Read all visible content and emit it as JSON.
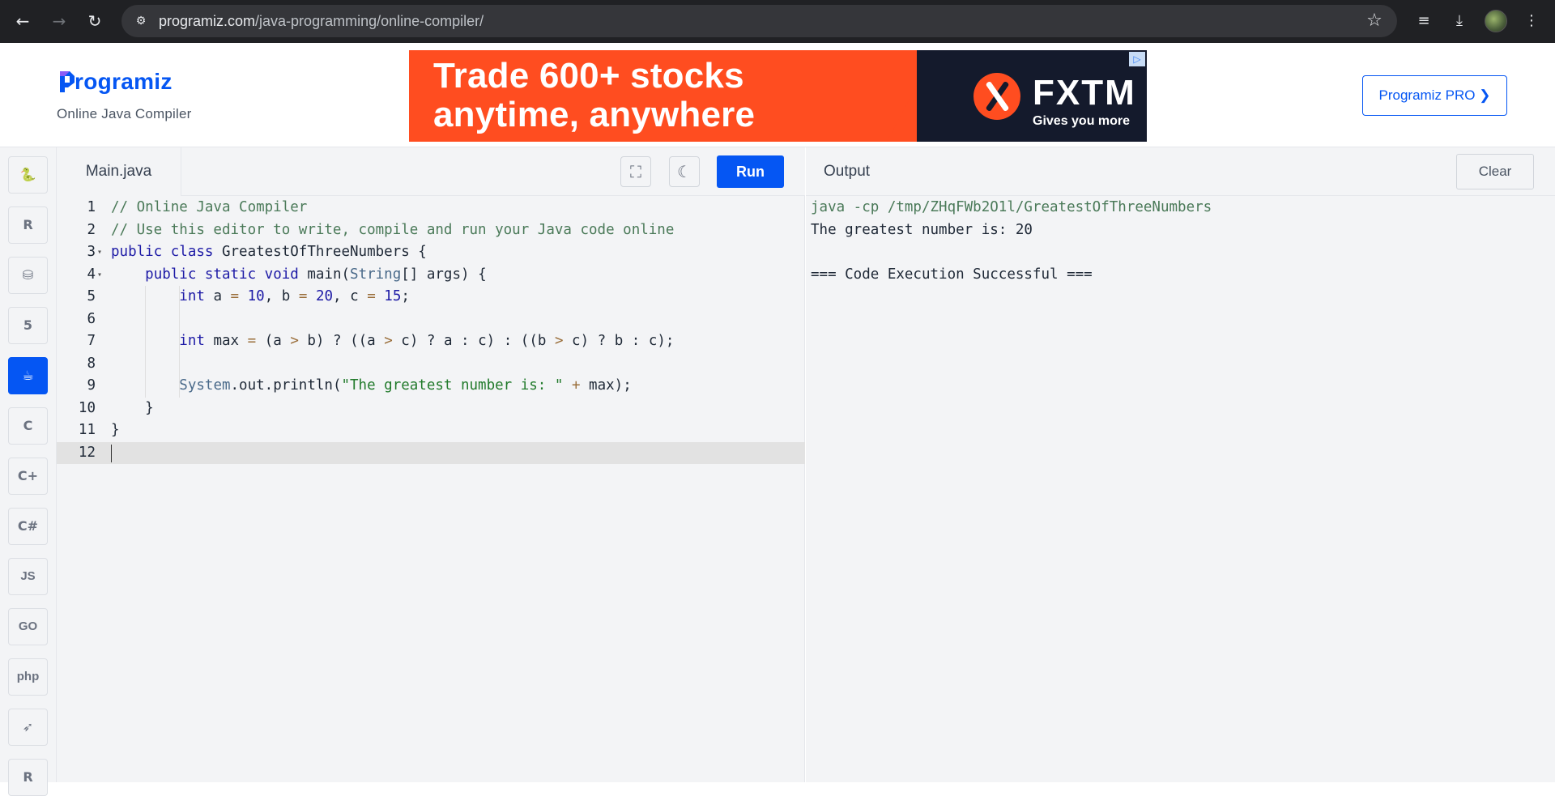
{
  "browser": {
    "url_domain": "programiz.com",
    "url_path": "/java-programming/online-compiler/"
  },
  "header": {
    "logo_text": "rogramiz",
    "subtitle": "Online Java Compiler",
    "pro_button": "Programiz PRO ❯",
    "ad": {
      "headline_1": "Trade 600+ stocks",
      "headline_2": "anytime, anywhere",
      "brand": "FXTM",
      "tagline": "Gives you more"
    },
    "brand_color": "#0556f3"
  },
  "rail": {
    "items": [
      {
        "name": "python-icon",
        "glyph": "🐍"
      },
      {
        "name": "r-icon",
        "glyph": "R"
      },
      {
        "name": "sql-icon",
        "glyph": "⛁"
      },
      {
        "name": "html5-icon",
        "glyph": "5"
      },
      {
        "name": "java-icon",
        "glyph": "☕"
      },
      {
        "name": "c-icon",
        "glyph": "C"
      },
      {
        "name": "cplusplus-icon",
        "glyph": "C+"
      },
      {
        "name": "csharp-icon",
        "glyph": "C#"
      },
      {
        "name": "javascript-icon",
        "glyph": "JS"
      },
      {
        "name": "go-icon",
        "glyph": "GO"
      },
      {
        "name": "php-icon",
        "glyph": "php"
      },
      {
        "name": "swift-icon",
        "glyph": "➶"
      },
      {
        "name": "rust-icon",
        "glyph": "R"
      }
    ],
    "active_index": 4
  },
  "editor": {
    "file_tab": "Main.java",
    "run_label": "Run",
    "lines": [
      [
        [
          "c",
          "// Online Java Compiler"
        ]
      ],
      [
        [
          "c",
          "// Use this editor to write, compile and run your Java code online"
        ]
      ],
      [
        [
          "k",
          "public class "
        ],
        [
          "p",
          "GreatestOfThreeNumbers {"
        ]
      ],
      [
        [
          "p",
          "    "
        ],
        [
          "k",
          "public static void "
        ],
        [
          "p",
          "main("
        ],
        [
          "t",
          "String"
        ],
        [
          "p",
          "[] args) {"
        ]
      ],
      [
        [
          "p",
          "        "
        ],
        [
          "k",
          "int "
        ],
        [
          "p",
          "a "
        ],
        [
          "o",
          "="
        ],
        [
          "p",
          " "
        ],
        [
          "n",
          "10"
        ],
        [
          "p",
          ", b "
        ],
        [
          "o",
          "="
        ],
        [
          "p",
          " "
        ],
        [
          "n",
          "20"
        ],
        [
          "p",
          ", c "
        ],
        [
          "o",
          "="
        ],
        [
          "p",
          " "
        ],
        [
          "n",
          "15"
        ],
        [
          "p",
          ";"
        ]
      ],
      [
        [
          "p",
          ""
        ]
      ],
      [
        [
          "p",
          "        "
        ],
        [
          "k",
          "int "
        ],
        [
          "p",
          "max "
        ],
        [
          "o",
          "="
        ],
        [
          "p",
          " (a "
        ],
        [
          "o",
          ">"
        ],
        [
          "p",
          " b) ? ((a "
        ],
        [
          "o",
          ">"
        ],
        [
          "p",
          " c) ? a : c) : ((b "
        ],
        [
          "o",
          ">"
        ],
        [
          "p",
          " c) ? b : c);"
        ]
      ],
      [
        [
          "p",
          ""
        ]
      ],
      [
        [
          "p",
          "        "
        ],
        [
          "t",
          "System"
        ],
        [
          "p",
          ".out.println("
        ],
        [
          "s",
          "\"The greatest number is: \""
        ],
        [
          "p",
          " "
        ],
        [
          "o",
          "+"
        ],
        [
          "p",
          " max);"
        ]
      ],
      [
        [
          "p",
          "    }"
        ]
      ],
      [
        [
          "p",
          "}"
        ]
      ],
      [
        [
          "p",
          ""
        ]
      ]
    ],
    "fold_lines": [
      3,
      4
    ],
    "active_line": 12
  },
  "output": {
    "title": "Output",
    "clear_label": "Clear",
    "lines": [
      {
        "text": "java -cp /tmp/ZHqFWb2O1l/GreatestOfThreeNumbers",
        "kind": "cmd"
      },
      {
        "text": "The greatest number is: 20",
        "kind": "out"
      },
      {
        "text": "",
        "kind": "out"
      },
      {
        "text": "=== Code Execution Successful ===",
        "kind": "out"
      }
    ]
  }
}
